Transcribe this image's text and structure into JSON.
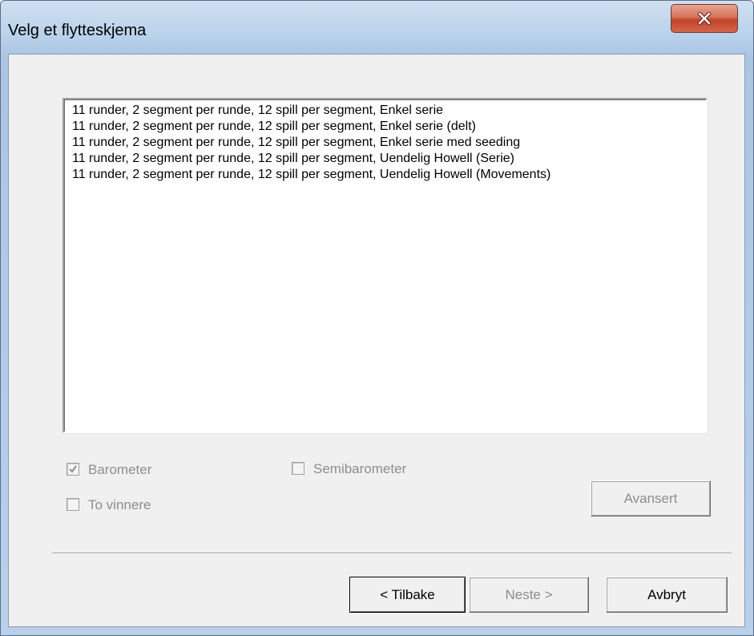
{
  "window": {
    "title": "Velg et flytteskjema"
  },
  "list": {
    "items": [
      "11 runder, 2 segment per runde, 12 spill per segment, Enkel serie",
      "11 runder, 2 segment per runde, 12 spill per segment, Enkel serie (delt)",
      "11 runder, 2 segment per runde, 12 spill per segment, Enkel serie med seeding",
      "11 runder, 2 segment per runde, 12 spill per segment, Uendelig Howell (Serie)",
      "11 runder, 2 segment per runde, 12 spill per segment, Uendelig Howell (Movements)"
    ]
  },
  "options": {
    "barometer": {
      "label": "Barometer",
      "checked": true,
      "enabled": false
    },
    "semibarometer": {
      "label": "Semibarometer",
      "checked": false,
      "enabled": false
    },
    "to_vinnere": {
      "label": "To vinnere",
      "checked": false,
      "enabled": false
    }
  },
  "buttons": {
    "advanced": "Avansert",
    "back": "< Tilbake",
    "next": "Neste >",
    "cancel": "Avbryt"
  },
  "icons": {
    "close": "close-icon",
    "check": "checkmark-icon"
  }
}
